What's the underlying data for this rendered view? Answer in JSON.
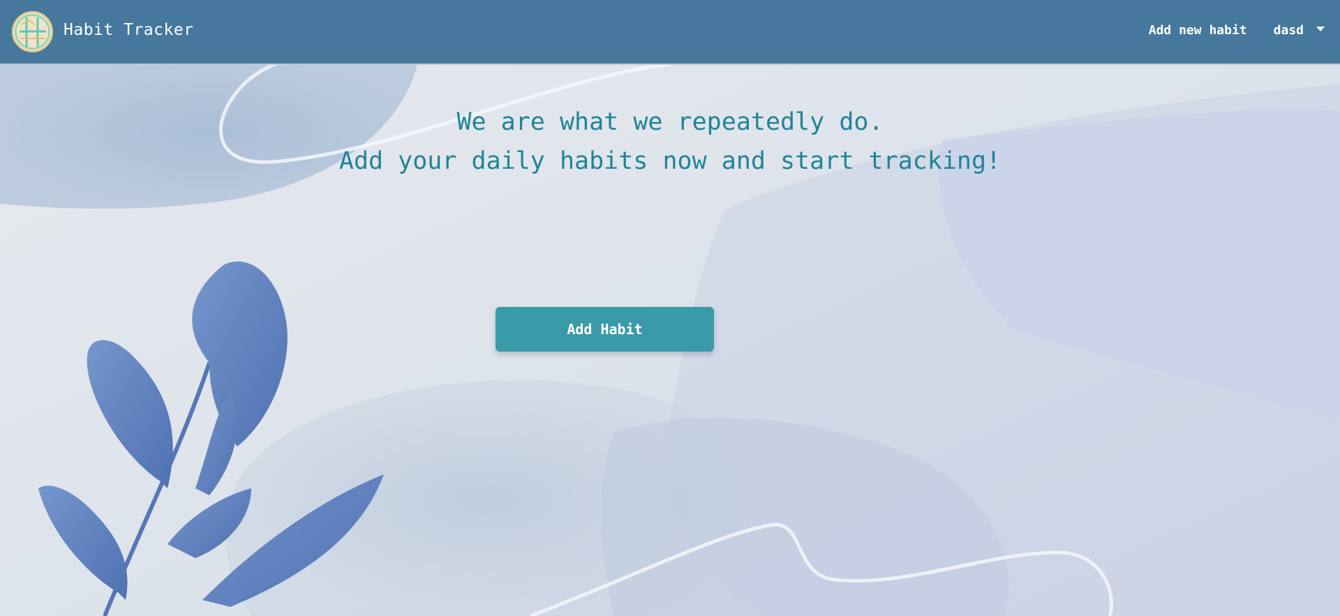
{
  "navbar": {
    "brand_name": "Habit Tracker",
    "add_new_habit_label": "Add new habit",
    "user_name": "dasd"
  },
  "hero": {
    "line1": "We are what we repeatedly do.",
    "line2": "Add your daily habits now and start tracking!"
  },
  "actions": {
    "add_habit_label": "Add Habit"
  },
  "colors": {
    "navbar_bg": "#45789c",
    "hero_text": "#1f8497",
    "button_bg": "#3a9ba8",
    "leaf": "#4f78bd"
  },
  "icons": {
    "brand_logo": "habit-tracker-logo",
    "user_menu": "caret-down-icon"
  }
}
